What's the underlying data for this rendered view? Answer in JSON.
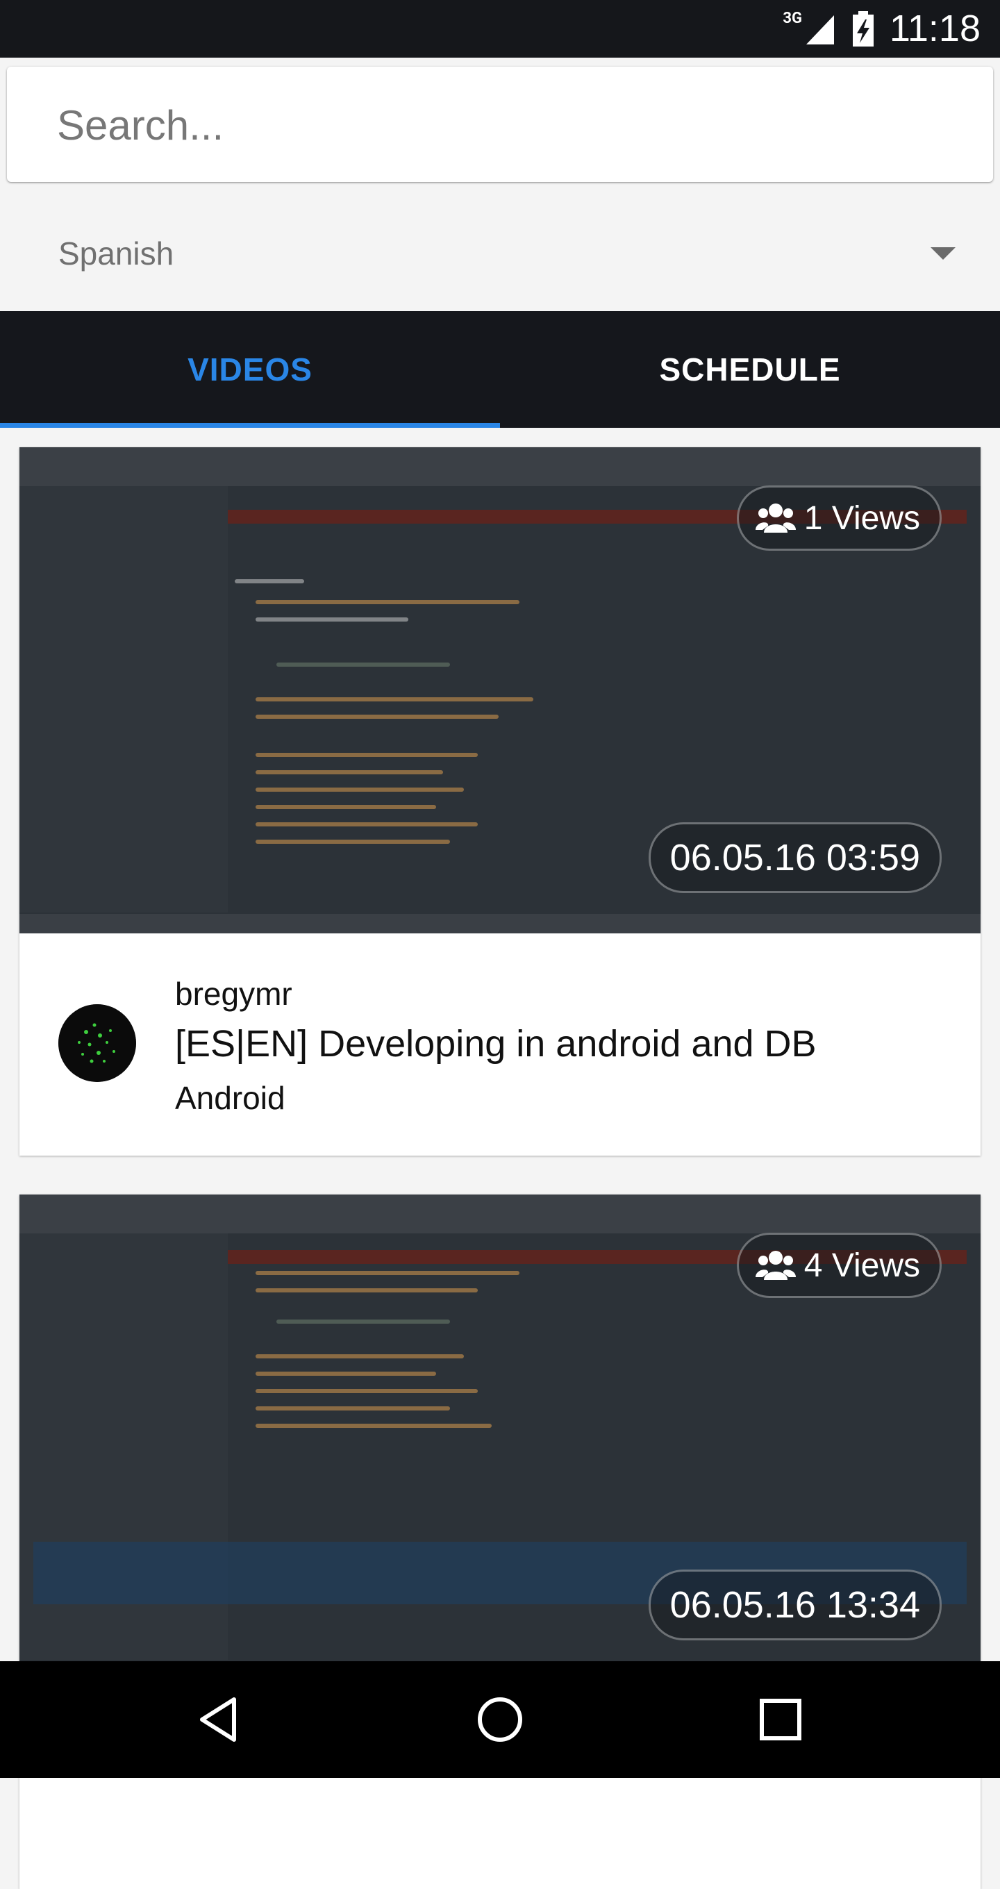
{
  "status_bar": {
    "network": "3G",
    "time": "11:18"
  },
  "search": {
    "placeholder": "Search..."
  },
  "language": {
    "selected": "Spanish"
  },
  "tabs": [
    {
      "label": "VIDEOS",
      "active": true
    },
    {
      "label": "SCHEDULE",
      "active": false
    }
  ],
  "videos": [
    {
      "views": "1 Views",
      "date": "06.05.16 03:59",
      "author": "bregymr",
      "title": "[ES|EN] Developing in android and DB",
      "category": "Android"
    },
    {
      "views": "4 Views",
      "date": "06.05.16 13:34"
    }
  ],
  "colors": {
    "accent": "#2a86e6",
    "tabbar": "#15171c",
    "status_bar": "#15171b"
  }
}
